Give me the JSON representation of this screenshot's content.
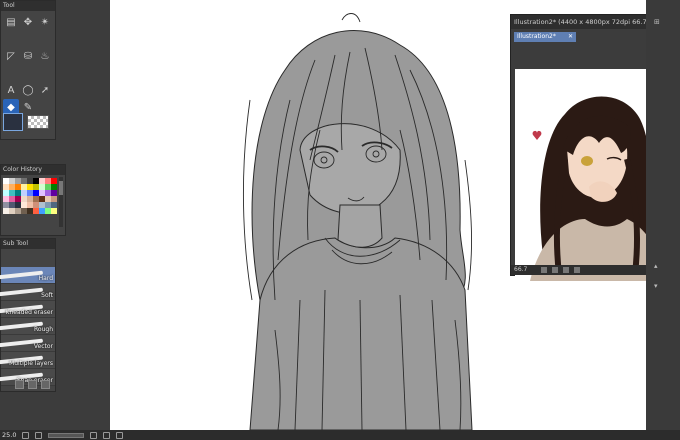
{
  "tool_panel": {
    "title": "Tool",
    "tools": [
      {
        "name": "pen-tab-icon",
        "glyph": "▤"
      },
      {
        "name": "move-icon",
        "glyph": "✥"
      },
      {
        "name": "magic-wand-icon",
        "glyph": "✴"
      },
      {
        "name": "ruler-icon",
        "glyph": "◸"
      },
      {
        "name": "fill-bucket-icon",
        "glyph": "⛁"
      },
      {
        "name": "blend-icon",
        "glyph": "♨"
      },
      {
        "name": "text-icon",
        "glyph": "A"
      },
      {
        "name": "lasso-icon",
        "glyph": "◯"
      },
      {
        "name": "object-select-icon",
        "glyph": "➚"
      },
      {
        "name": "eraser-tool-icon",
        "glyph": "◆"
      },
      {
        "name": "pen-tool-icon",
        "glyph": "✎"
      }
    ]
  },
  "color_history": {
    "title": "Color History",
    "colors": [
      "#ffffff",
      "#d0d0d0",
      "#a0a0a0",
      "#707070",
      "#404040",
      "#000000",
      "#ffd0d0",
      "#ff8080",
      "#ff0000",
      "#ffe0c0",
      "#ffb060",
      "#ff8000",
      "#fff0a0",
      "#ffe000",
      "#c0c000",
      "#d0ffd0",
      "#60d060",
      "#008000",
      "#c0ffff",
      "#40c0c0",
      "#008080",
      "#c0d0ff",
      "#6080ff",
      "#0000ff",
      "#e0c0ff",
      "#a060e0",
      "#6000a0",
      "#ffc0e0",
      "#e060a0",
      "#a00050",
      "#f0d8c8",
      "#d8b098",
      "#a07050",
      "#603018",
      "#e8c8b0",
      "#c89880",
      "#9090a0",
      "#505870",
      "#283040",
      "#ffe8d8",
      "#f0c0a8",
      "#d09078",
      "#b0c0d0",
      "#8098b0",
      "#506880",
      "#f8f0e8",
      "#e0d0c0",
      "#b0a090",
      "#706050",
      "#403020",
      "#ff6040",
      "#40a0ff",
      "#80ff80",
      "#ffff80"
    ]
  },
  "subtool_panel": {
    "title": "Sub Tool",
    "brushes": [
      {
        "label": "Hard",
        "selected": true
      },
      {
        "label": "Soft",
        "selected": false
      },
      {
        "label": "Kneaded eraser",
        "selected": false
      },
      {
        "label": "Rough",
        "selected": false
      },
      {
        "label": "Vector",
        "selected": false
      },
      {
        "label": "Multiple layers",
        "selected": false
      },
      {
        "label": "Snap eraser",
        "selected": false
      }
    ]
  },
  "sub_window": {
    "title": "Illustration2* (4400 x 4800px 72dpi 66.7%) - C",
    "tab_label": "Illustration2*",
    "zoom": "66.7",
    "page": "0.0"
  },
  "status_bar": {
    "zoom": "25.0"
  },
  "colors": {
    "accent": "#2a64b8",
    "tab": "#5f7fb3",
    "panel": "#444444",
    "canvas": "#ffffff"
  }
}
